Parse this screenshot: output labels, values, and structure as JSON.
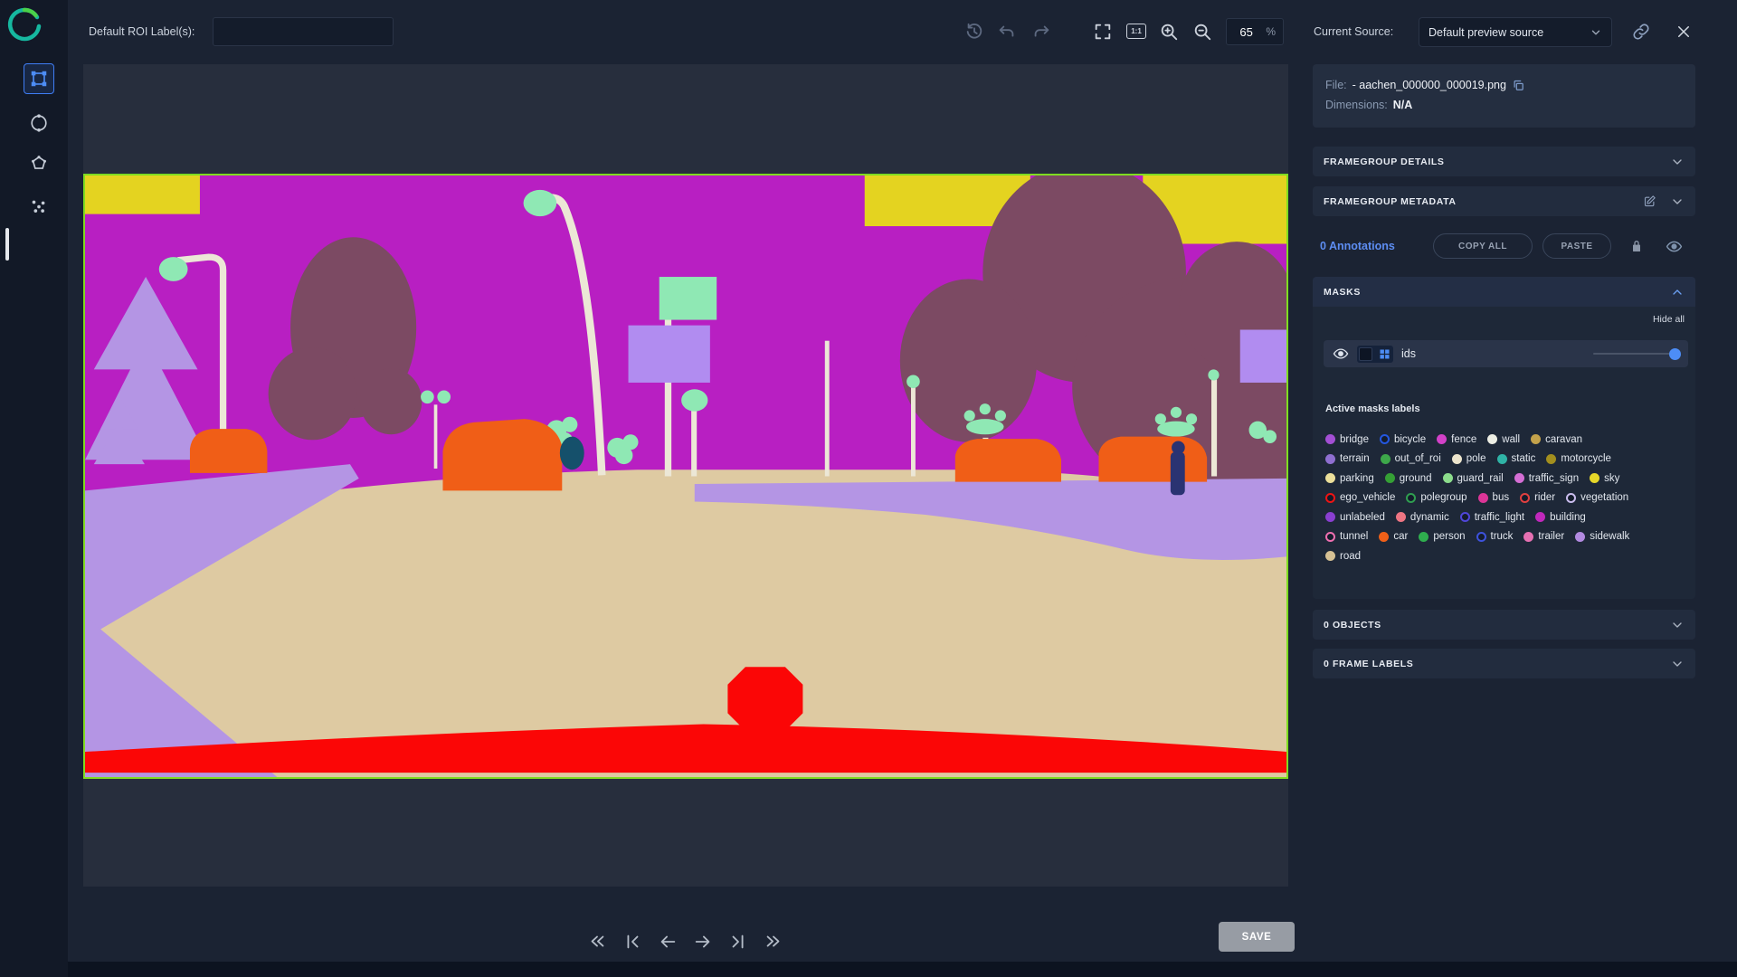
{
  "topbar": {
    "roi_label": "Default ROI Label(s):",
    "zoom_value": "65",
    "zoom_unit": "%"
  },
  "source_bar": {
    "label": "Current Source:",
    "selected": "Default preview source"
  },
  "file_info": {
    "file_label": "File:",
    "file_name": "- aachen_000000_000019.png",
    "dimensions_label": "Dimensions:",
    "dimensions_value": "N/A"
  },
  "sections": {
    "framegroup_details": "FRAMEGROUP DETAILS",
    "framegroup_metadata": "FRAMEGROUP METADATA",
    "objects": "0 OBJECTS",
    "frame_labels": "0 FRAME LABELS"
  },
  "annotations": {
    "count": "0 Annotations",
    "copy_all": "COPY ALL",
    "paste": "PASTE"
  },
  "masks": {
    "title": "MASKS",
    "hide_all": "Hide all",
    "layer_name": "ids",
    "active_labels_title": "Active masks labels",
    "labels": [
      {
        "name": "bridge",
        "color": "#a34fd4",
        "style": "filled"
      },
      {
        "name": "bicycle",
        "color": "#2457e0",
        "style": "ring"
      },
      {
        "name": "fence",
        "color": "#d241c8",
        "style": "filled"
      },
      {
        "name": "wall",
        "color": "#edeee4",
        "style": "filled"
      },
      {
        "name": "caravan",
        "color": "#c3a24b",
        "style": "filled"
      },
      {
        "name": "terrain",
        "color": "#8f6fd0",
        "style": "filled"
      },
      {
        "name": "out_of_roi",
        "color": "#3da84a",
        "style": "filled"
      },
      {
        "name": "pole",
        "color": "#ece5cd",
        "style": "filled"
      },
      {
        "name": "static",
        "color": "#2fb3a6",
        "style": "filled"
      },
      {
        "name": "motorcycle",
        "color": "#a38f1e",
        "style": "filled"
      },
      {
        "name": "parking",
        "color": "#ecdf9a",
        "style": "filled"
      },
      {
        "name": "ground",
        "color": "#35a035",
        "style": "filled"
      },
      {
        "name": "guard_rail",
        "color": "#8cdc8c",
        "style": "filled"
      },
      {
        "name": "traffic_sign",
        "color": "#d46ed4",
        "style": "filled"
      },
      {
        "name": "sky",
        "color": "#e6d729",
        "style": "filled"
      },
      {
        "name": "ego_vehicle",
        "color": "#ee1414",
        "style": "ring"
      },
      {
        "name": "polegroup",
        "color": "#2f9e50",
        "style": "ring"
      },
      {
        "name": "bus",
        "color": "#dc3597",
        "style": "filled"
      },
      {
        "name": "rider",
        "color": "#e04040",
        "style": "ring"
      },
      {
        "name": "vegetation",
        "color": "#c9bced",
        "style": "ring"
      },
      {
        "name": "unlabeled",
        "color": "#8a3fd0",
        "style": "filled"
      },
      {
        "name": "dynamic",
        "color": "#ee7583",
        "style": "filled"
      },
      {
        "name": "traffic_light",
        "color": "#4f46d8",
        "style": "ring"
      },
      {
        "name": "building",
        "color": "#c128bc",
        "style": "filled"
      },
      {
        "name": "tunnel",
        "color": "#ee6fb0",
        "style": "ring"
      },
      {
        "name": "car",
        "color": "#f06018",
        "style": "filled"
      },
      {
        "name": "person",
        "color": "#2fae4e",
        "style": "filled"
      },
      {
        "name": "truck",
        "color": "#3d52dc",
        "style": "ring"
      },
      {
        "name": "trailer",
        "color": "#e670b2",
        "style": "filled"
      },
      {
        "name": "sidewalk",
        "color": "#b28ae0",
        "style": "filled"
      },
      {
        "name": "road",
        "color": "#d6c194",
        "style": "filled"
      }
    ]
  },
  "footer": {
    "save": "SAVE"
  },
  "scene_colors": {
    "building": "#b81fc2",
    "sky_patch": "#e4d320",
    "vegetation": "#7c4a63",
    "sidewalk": "#b495e4",
    "road": "#decaa2",
    "pole": "#ece7d6",
    "lamp": "#8fe8b4",
    "sign": "#b18cf0",
    "car": "#f05e17",
    "dark_object": "#15506b",
    "figure": "#2a3372",
    "ego": "#fb0606",
    "image_border": "#7fdc20"
  }
}
